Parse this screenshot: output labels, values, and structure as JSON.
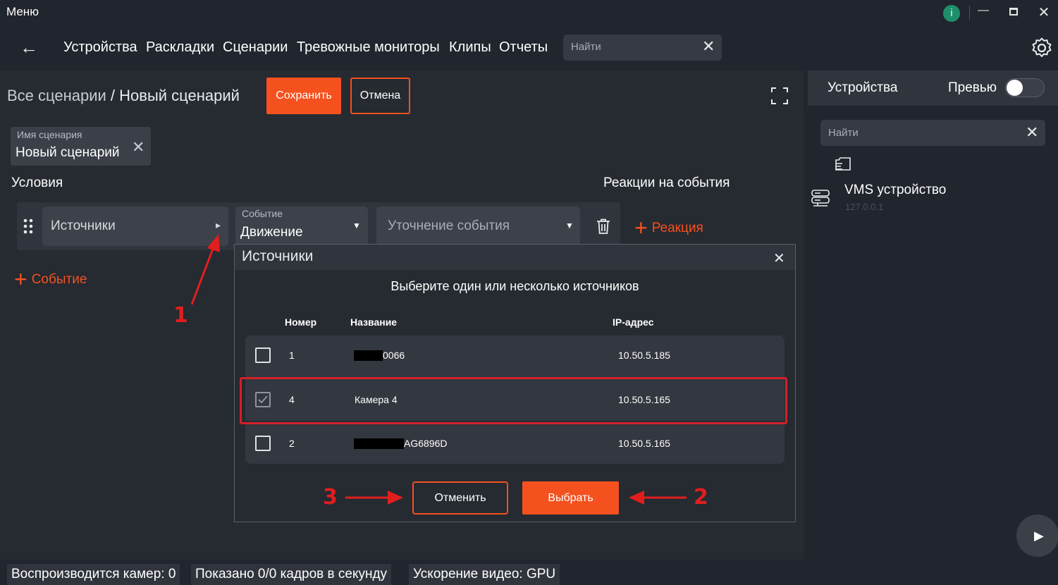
{
  "titlebar": {
    "menu_label": "Меню",
    "info_glyph": "i"
  },
  "nav": {
    "items": [
      "Устройства",
      "Раскладки",
      "Сценарии",
      "Тревожные мониторы",
      "Клипы",
      "Отчеты"
    ],
    "search_placeholder": "Найти"
  },
  "header": {
    "breadcrumb_root": "Все сценарии",
    "breadcrumb_sep": " / ",
    "breadcrumb_current": "Новый сценарий",
    "save_label": "Сохранить",
    "cancel_label": "Отмена"
  },
  "scenario_name": {
    "label": "Имя сценария",
    "value": "Новый сценарий"
  },
  "conditions": {
    "title": "Условия",
    "sources_placeholder": "Источники",
    "event_label": "Событие",
    "event_value": "Движение",
    "refine_placeholder": "Уточнение события",
    "add_event_label": "Событие"
  },
  "reactions": {
    "title": "Реакции на события",
    "add_label": "Реакция"
  },
  "annotations": {
    "n1": "1",
    "n2": "2",
    "n3": "3"
  },
  "dialog": {
    "title": "Источники",
    "subtitle": "Выберите один или несколько источников",
    "columns": [
      "Номер",
      "Название",
      "IP-адрес"
    ],
    "rows": [
      {
        "number": "1",
        "name": "0066",
        "ip": "10.50.5.185",
        "checked": false
      },
      {
        "number": "4",
        "name": "Камера 4",
        "ip": "10.50.5.165",
        "checked": true
      },
      {
        "number": "2",
        "name": "AG6896D",
        "ip": "10.50.5.165",
        "checked": false
      }
    ],
    "cancel_label": "Отменить",
    "select_label": "Выбрать"
  },
  "right_panel": {
    "title": "Устройства",
    "preview_label": "Превью",
    "preview_on": false,
    "search_placeholder": "Найти",
    "device_name": "VMS устройство",
    "device_ip": "127.0.0.1"
  },
  "status": {
    "cameras": "Воспроизводится камер: 0",
    "fps": "Показано 0/0 кадров в секунду",
    "accel": "Ускорение видео: GPU"
  },
  "colors": {
    "accent": "#f4511e",
    "highlight": "#d3202b",
    "background": "#21252d",
    "info": "#1e8f6a"
  }
}
